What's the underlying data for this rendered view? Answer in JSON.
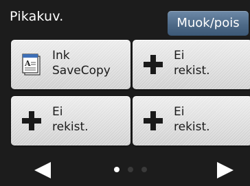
{
  "header": {
    "title": "Pikakuv.",
    "edit_button_label": "Muok/pois"
  },
  "tiles": [
    {
      "line1": "Ink",
      "line2": "SaveCopy",
      "icon": "document-icon"
    },
    {
      "line1": "Ei",
      "line2": "rekist.",
      "icon": "plus-icon"
    },
    {
      "line1": "Ei",
      "line2": "rekist.",
      "icon": "plus-icon"
    },
    {
      "line1": "Ei",
      "line2": "rekist.",
      "icon": "plus-icon"
    }
  ],
  "pager": {
    "total_pages": 3,
    "current_page": 1
  },
  "colors": {
    "background": "#1c1c1c",
    "header_button": "#4e6a88",
    "tile": "#dcdcdc",
    "arrow": "#ffffff",
    "dot_active": "#ffffff",
    "dot_inactive": "#3a3a3a"
  }
}
